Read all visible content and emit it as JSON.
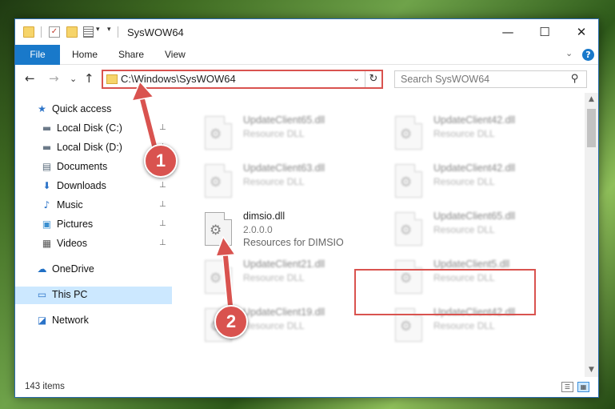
{
  "window": {
    "title": "SysWOW64",
    "controls": {
      "minimize": "—",
      "maximize": "☐",
      "close": "✕"
    }
  },
  "ribbon": {
    "tabs": [
      "File",
      "Home",
      "Share",
      "View"
    ],
    "help": "?",
    "collapse": "⌄"
  },
  "navigation": {
    "back": "←",
    "forward": "→",
    "recent": "⌄",
    "up": "↑",
    "address": "C:\\Windows\\SysWOW64",
    "address_drop": "⌄",
    "refresh": "↻",
    "search_placeholder": "Search SysWOW64",
    "search_icon": "⚲"
  },
  "sidebar": {
    "items": [
      {
        "label": "Quick access",
        "icon": "star-icon",
        "glyph": "★",
        "color": "#2b73c8",
        "pinned": false
      },
      {
        "label": "Local Disk (C:)",
        "icon": "drive-icon",
        "glyph": "▬",
        "color": "#6c7a89",
        "pinned": true
      },
      {
        "label": "Local Disk (D:)",
        "icon": "drive-icon",
        "glyph": "▬",
        "color": "#6c7a89",
        "pinned": true
      },
      {
        "label": "Documents",
        "icon": "document-icon",
        "glyph": "▤",
        "color": "#5b6c7c",
        "pinned": true
      },
      {
        "label": "Downloads",
        "icon": "download-icon",
        "glyph": "⬇",
        "color": "#2b73c8",
        "pinned": true
      },
      {
        "label": "Music",
        "icon": "music-icon",
        "glyph": "♪",
        "color": "#2b73c8",
        "pinned": true
      },
      {
        "label": "Pictures",
        "icon": "pictures-icon",
        "glyph": "▣",
        "color": "#3a8fd0",
        "pinned": true
      },
      {
        "label": "Videos",
        "icon": "video-icon",
        "glyph": "▦",
        "color": "#555",
        "pinned": true
      },
      {
        "label": "OneDrive",
        "icon": "cloud-icon",
        "glyph": "☁",
        "color": "#1f6fc4",
        "pinned": false
      },
      {
        "label": "This PC",
        "icon": "computer-icon",
        "glyph": "▭",
        "color": "#2b73c8",
        "pinned": false
      },
      {
        "label": "Network",
        "icon": "network-icon",
        "glyph": "◪",
        "color": "#2b73c8",
        "pinned": false
      }
    ],
    "pin_glyph": "📌"
  },
  "files": [
    {
      "name": "UpdateClient65.dll",
      "desc": "Resource DLL"
    },
    {
      "name": "UpdateClient42.dll",
      "desc": "Resource DLL"
    },
    {
      "name": "UpdateClient63.dll",
      "desc": "Resource DLL"
    },
    {
      "name": "UpdateClient42.dll",
      "desc": "Resource DLL"
    },
    {
      "name": "dimsio.dll",
      "desc": "2.0.0.0",
      "desc2": "Resources for DIMSIO"
    },
    {
      "name": "UpdateClient65.dll",
      "desc": "Resource DLL"
    },
    {
      "name": "UpdateClient21.dll",
      "desc": "Resource DLL"
    },
    {
      "name": "UpdateClient5.dll",
      "desc": "Resource DLL"
    },
    {
      "name": "UpdateClient19.dll",
      "desc": "Resource DLL"
    },
    {
      "name": "UpdateClient42.dll",
      "desc": "Resource DLL"
    }
  ],
  "status": {
    "count": "143 items"
  },
  "annotations": {
    "step1": "1",
    "step2": "2",
    "color": "#d9534f"
  }
}
